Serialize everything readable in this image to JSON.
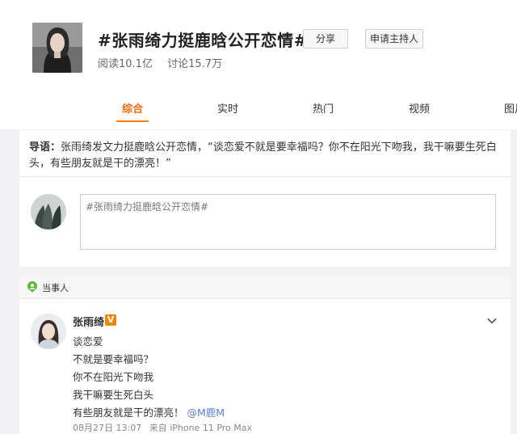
{
  "topic": {
    "title": "#张雨绮力挺鹿晗公开恋情#",
    "share_label": "分享",
    "host_label": "申请主持人",
    "reads": "阅读10.1亿",
    "discussions": "讨论15.7万"
  },
  "tabs": [
    "综合",
    "实时",
    "热门",
    "视频",
    "图片"
  ],
  "active_tab": "综合",
  "intro": {
    "label": "导语：",
    "text": "张雨绮发文力挺鹿晗公开恋情，“谈恋爱不就是要幸福吗？你不在阳光下吻我，我干嘛要生死白头，有些朋友就是干的漂亮！”"
  },
  "compose": {
    "value": "#张雨绮力挺鹿晗公开恋情#"
  },
  "section": {
    "label": "当事人"
  },
  "post": {
    "author": "张雨绮",
    "badge": "V",
    "lines": [
      "谈恋爱",
      "不就是要幸福吗？",
      "你不在阳光下吻我",
      "我干嘛要生死白头",
      "有些朋友就是干的漂亮！"
    ],
    "mention": "@M鹿M",
    "date": "08月27日 13:07",
    "source": "来自 iPhone 11 Pro Max"
  },
  "colors": {
    "accent": "#ff8200",
    "link": "#5d7ed3",
    "badge": "#f08600"
  }
}
